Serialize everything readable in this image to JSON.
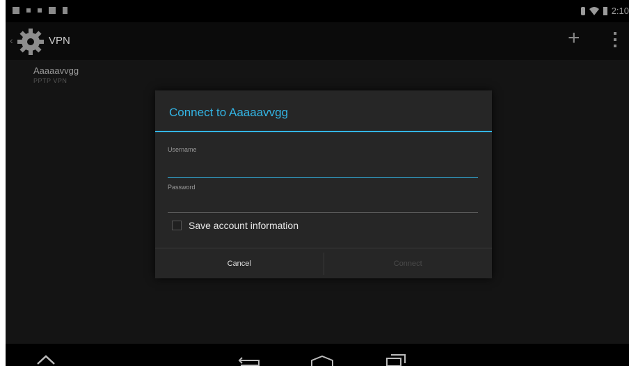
{
  "status_bar": {
    "time": "2:10",
    "left_icons": [
      "notification-icon",
      "usb-icon",
      "dot-icon",
      "image-icon",
      "sd-card-icon"
    ],
    "right_icons": [
      "bluetooth-icon",
      "wifi-icon",
      "battery-icon"
    ]
  },
  "action_bar": {
    "title": "VPN",
    "add_label": "+"
  },
  "vpn_list": [
    {
      "name": "Aaaaavvgg",
      "type": "PPTP VPN"
    }
  ],
  "dialog": {
    "title": "Connect to Aaaaavvgg",
    "username_label": "Username",
    "username_value": "",
    "password_label": "Password",
    "password_value": "",
    "save_checkbox_label": "Save account information",
    "save_checked": false,
    "cancel_label": "Cancel",
    "connect_label": "Connect"
  },
  "colors": {
    "accent": "#33b5e5",
    "dialog_bg": "#262626",
    "screen_bg": "#141414"
  },
  "nav_icons": [
    "keyboard-hide-icon",
    "back-icon",
    "home-icon",
    "recents-icon"
  ]
}
